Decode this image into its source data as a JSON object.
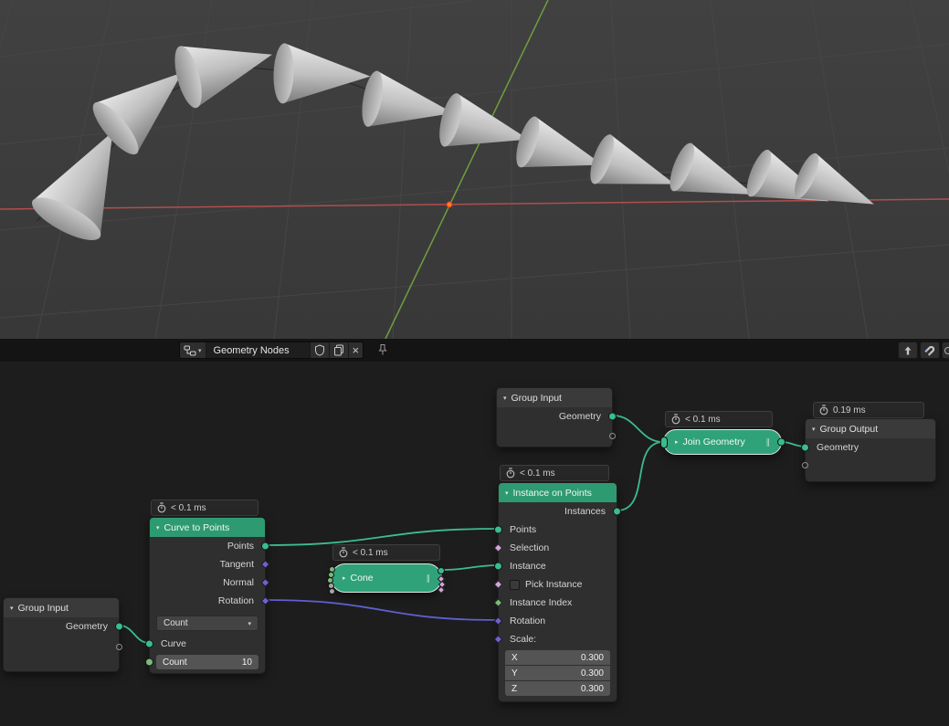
{
  "editor_header": {
    "tree_name": "Geometry Nodes",
    "icons": [
      "node-tree-icon",
      "dropdown-chevron-icon",
      "shield-icon",
      "duplicate-icon",
      "close-icon",
      "pin-icon",
      "parent-arrow-icon",
      "magnet-icon"
    ]
  },
  "colors": {
    "node_header_green": "#2d9a72",
    "selected_pill_green": "#2fa27a",
    "socket_geometry": "#39bd8d",
    "socket_vector": "#6c63cf",
    "socket_boolean": "#d2a6da",
    "socket_integer": "#7db87d",
    "link_geometry": "#3cbd8e",
    "link_rotation": "#5f5fd3",
    "axis_x": "#b34d4d",
    "axis_y": "#6f9d3f"
  },
  "nodes": {
    "group_input_top": {
      "title": "Group Input",
      "output_label": "Geometry"
    },
    "join_geometry": {
      "timer": "< 0.1 ms",
      "title": "Join Geometry"
    },
    "group_output": {
      "timer": "0.19 ms",
      "title": "Group Output",
      "input_label": "Geometry"
    },
    "instance_on_points": {
      "timer": "< 0.1 ms",
      "title": "Instance on Points",
      "output_label": "Instances",
      "points_label": "Points",
      "selection_label": "Selection",
      "instance_label": "Instance",
      "pick_instance_label": "Pick Instance",
      "instance_index_label": "Instance Index",
      "rotation_label": "Rotation",
      "scale_label": "Scale:",
      "scale_x": {
        "axis": "X",
        "value": "0.300"
      },
      "scale_y": {
        "axis": "Y",
        "value": "0.300"
      },
      "scale_z": {
        "axis": "Z",
        "value": "0.300"
      }
    },
    "curve_to_points": {
      "timer": "< 0.1 ms",
      "title": "Curve to Points",
      "points_label": "Points",
      "tangent_label": "Tangent",
      "normal_label": "Normal",
      "rotation_label": "Rotation",
      "mode_value": "Count",
      "curve_label": "Curve",
      "count_label": "Count",
      "count_value": "10"
    },
    "cone": {
      "timer": "< 0.1 ms",
      "title": "Cone"
    },
    "group_input_bottom": {
      "title": "Group Input",
      "output_label": "Geometry"
    }
  }
}
